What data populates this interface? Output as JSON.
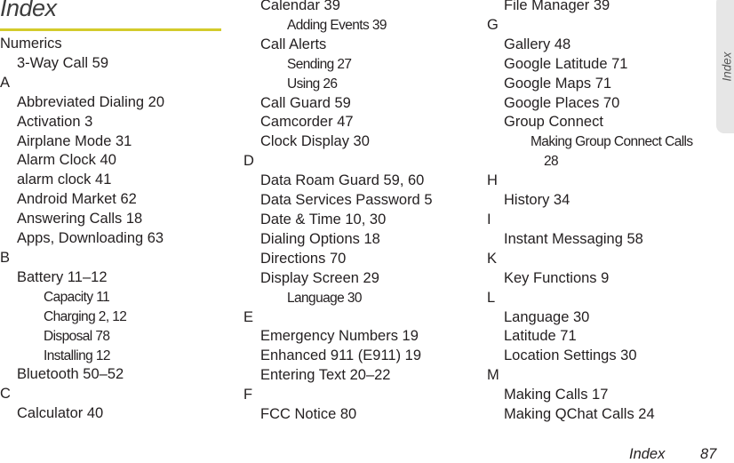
{
  "page": {
    "heading": "Index",
    "side_tab": "Index",
    "footer": {
      "section": "Index",
      "page_number": "87"
    },
    "colors": {
      "rule": "#d3cb2b",
      "side_tab_bg": "#e6e6e6"
    }
  },
  "columns": [
    {
      "entries": [
        {
          "level": 0,
          "text": "Numerics"
        },
        {
          "level": 1,
          "text": "3-Way Call 59"
        },
        {
          "level": 0,
          "text": "A"
        },
        {
          "level": 1,
          "text": "Abbreviated Dialing 20"
        },
        {
          "level": 1,
          "text": "Activation 3"
        },
        {
          "level": 1,
          "text": "Airplane Mode 31"
        },
        {
          "level": 1,
          "text": "Alarm Clock 40"
        },
        {
          "level": 1,
          "text": "alarm clock 41"
        },
        {
          "level": 1,
          "text": "Android Market 62"
        },
        {
          "level": 1,
          "text": "Answering Calls 18"
        },
        {
          "level": 1,
          "text": "Apps, Downloading 63"
        },
        {
          "level": 0,
          "text": "B"
        },
        {
          "level": 1,
          "text": "Battery 11–12"
        },
        {
          "level": 2,
          "text": "Capacity 11"
        },
        {
          "level": 2,
          "text": "Charging 2, 12"
        },
        {
          "level": 2,
          "text": "Disposal 78"
        },
        {
          "level": 2,
          "text": "Installing 12"
        },
        {
          "level": 1,
          "text": "Bluetooth 50–52"
        },
        {
          "level": 0,
          "text": "C"
        },
        {
          "level": 1,
          "text": "Calculator 40"
        }
      ]
    },
    {
      "entries": [
        {
          "level": 1,
          "text": "Calendar 39"
        },
        {
          "level": 2,
          "text": "Adding Events 39"
        },
        {
          "level": 1,
          "text": "Call Alerts"
        },
        {
          "level": 2,
          "text": "Sending 27"
        },
        {
          "level": 2,
          "text": "Using 26"
        },
        {
          "level": 1,
          "text": "Call Guard 59"
        },
        {
          "level": 1,
          "text": "Camcorder 47"
        },
        {
          "level": 1,
          "text": "Clock Display 30"
        },
        {
          "level": 0,
          "text": "D"
        },
        {
          "level": 1,
          "text": "Data Roam Guard 59, 60"
        },
        {
          "level": 1,
          "text": "Data Services Password 5"
        },
        {
          "level": 1,
          "text": "Date & Time 10, 30"
        },
        {
          "level": 1,
          "text": "Dialing Options 18"
        },
        {
          "level": 1,
          "text": "Directions 70"
        },
        {
          "level": 1,
          "text": "Display Screen 29"
        },
        {
          "level": 2,
          "text": "Language 30"
        },
        {
          "level": 0,
          "text": "E"
        },
        {
          "level": 1,
          "text": "Emergency Numbers 19"
        },
        {
          "level": 1,
          "text": "Enhanced 911 (E911) 19"
        },
        {
          "level": 1,
          "text": "Entering Text 20–22"
        },
        {
          "level": 0,
          "text": "F"
        },
        {
          "level": 1,
          "text": "FCC Notice 80"
        }
      ]
    },
    {
      "entries": [
        {
          "level": 1,
          "text": "File Manager 39"
        },
        {
          "level": 0,
          "text": "G"
        },
        {
          "level": 1,
          "text": "Gallery 48"
        },
        {
          "level": 1,
          "text": "Google Latitude 71"
        },
        {
          "level": 1,
          "text": "Google Maps 71"
        },
        {
          "level": 1,
          "text": "Google Places 70"
        },
        {
          "level": 1,
          "text": "Group Connect"
        },
        {
          "level": 2,
          "text": "Making Group Connect Calls"
        },
        {
          "level": 3,
          "text": "28"
        },
        {
          "level": 0,
          "text": "H"
        },
        {
          "level": 1,
          "text": "History 34"
        },
        {
          "level": 0,
          "text": "I"
        },
        {
          "level": 1,
          "text": "Instant Messaging 58"
        },
        {
          "level": 0,
          "text": "K"
        },
        {
          "level": 1,
          "text": "Key Functions 9"
        },
        {
          "level": 0,
          "text": "L"
        },
        {
          "level": 1,
          "text": "Language 30"
        },
        {
          "level": 1,
          "text": "Latitude 71"
        },
        {
          "level": 1,
          "text": "Location Settings 30"
        },
        {
          "level": 0,
          "text": "M"
        },
        {
          "level": 1,
          "text": "Making Calls 17"
        },
        {
          "level": 1,
          "text": "Making QChat Calls 24"
        }
      ]
    }
  ]
}
